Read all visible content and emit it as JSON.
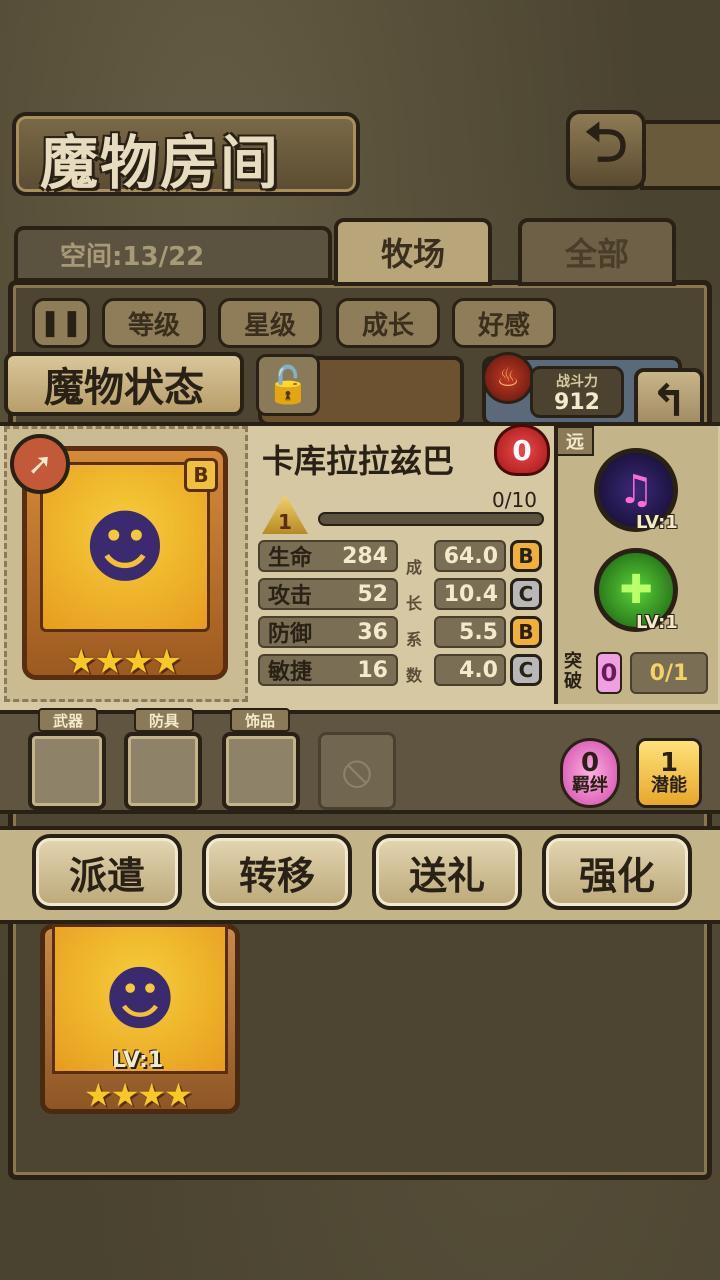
{
  "header": {
    "title": "魔物房间",
    "back_icon": "back-arrow-icon"
  },
  "space": {
    "label": "空间:13/22"
  },
  "tabs": [
    {
      "label": "牧场",
      "active": true
    },
    {
      "label": "全部",
      "active": false
    }
  ],
  "sort": {
    "pause_icon": "pause-sort-icon",
    "buttons": [
      "等级",
      "星级",
      "成长",
      "好感"
    ]
  },
  "status": {
    "banner": "魔物状态",
    "power_label": "战斗力",
    "power_value": "912",
    "rank": "B",
    "name": "卡库拉拉兹巴",
    "affection": "0",
    "level": "1",
    "exp": "0/10",
    "exp_fraction": 0.0,
    "star_count": 4,
    "stats": [
      {
        "label": "生命",
        "value": "284",
        "growth": "64.0",
        "grade": "B"
      },
      {
        "label": "攻击",
        "value": "52",
        "growth": "10.4",
        "grade": "C"
      },
      {
        "label": "防御",
        "value": "36",
        "growth": "5.5",
        "grade": "B"
      },
      {
        "label": "敏捷",
        "value": "16",
        "growth": "4.0",
        "grade": "C"
      }
    ],
    "growth_chars": [
      "成",
      "长",
      "系",
      "数"
    ],
    "range": "远",
    "skills": [
      {
        "icon": "music-note-icon",
        "lv": "LV:1"
      },
      {
        "icon": "green-cross-icon",
        "lv": "LV:1"
      }
    ],
    "breakthrough": {
      "label": "突破",
      "value": "0",
      "count": "0/1"
    }
  },
  "equipment": {
    "labels": [
      "武器",
      "防具",
      "饰品"
    ],
    "bond": {
      "value": "0",
      "label": "羁绊"
    },
    "potential": {
      "value": "1",
      "label": "潜能"
    }
  },
  "actions": [
    "派遣",
    "转移",
    "送礼",
    "强化"
  ],
  "lower_card": {
    "lv": "LV:1",
    "star_count": 4
  }
}
